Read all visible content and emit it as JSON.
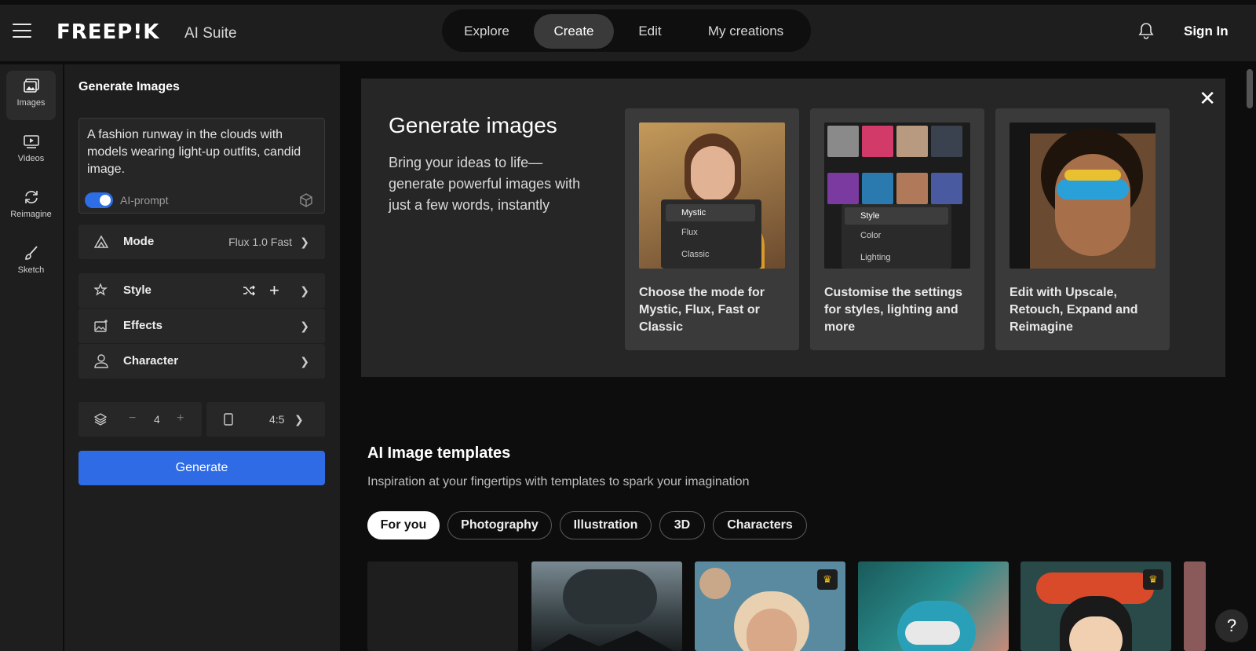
{
  "header": {
    "logo": "FREEP!K",
    "suite": "AI Suite",
    "nav": [
      "Explore",
      "Create",
      "Edit",
      "My creations"
    ],
    "active_nav": "Create",
    "sign_in": "Sign In"
  },
  "rail": {
    "items": [
      {
        "label": "Images",
        "icon": "image-icon"
      },
      {
        "label": "Videos",
        "icon": "video-icon"
      },
      {
        "label": "Reimagine",
        "icon": "reimagine-icon"
      },
      {
        "label": "Sketch",
        "icon": "brush-icon"
      }
    ]
  },
  "panel": {
    "title": "Generate Images",
    "prompt": "A fashion runway in the clouds with models wearing light-up outfits, candid image.",
    "ai_prompt_label": "AI-prompt",
    "ai_prompt_enabled": true,
    "mode_label": "Mode",
    "mode_value": "Flux 1.0 Fast",
    "style_label": "Style",
    "effects_label": "Effects",
    "character_label": "Character",
    "count": "4",
    "ratio": "4:5",
    "generate_label": "Generate"
  },
  "hero": {
    "title": "Generate images",
    "description": "Bring your ideas to life—generate powerful images with just a few words, instantly",
    "cards": [
      {
        "text": "Choose the mode for Mystic, Flux, Fast or Classic",
        "menu": [
          "Mystic",
          "Flux",
          "Classic"
        ]
      },
      {
        "text": "Customise the settings for styles, lighting and more",
        "menu": [
          "Style",
          "Color",
          "Lighting"
        ]
      },
      {
        "text": "Edit with Upscale, Retouch, Expand and Reimagine"
      }
    ]
  },
  "templates": {
    "title": "AI Image templates",
    "subtitle": "Inspiration at your fingertips with templates to spark your imagination",
    "chips": [
      "For you",
      "Photography",
      "Illustration",
      "3D",
      "Characters"
    ],
    "active_chip": "For you"
  },
  "help_label": "?"
}
